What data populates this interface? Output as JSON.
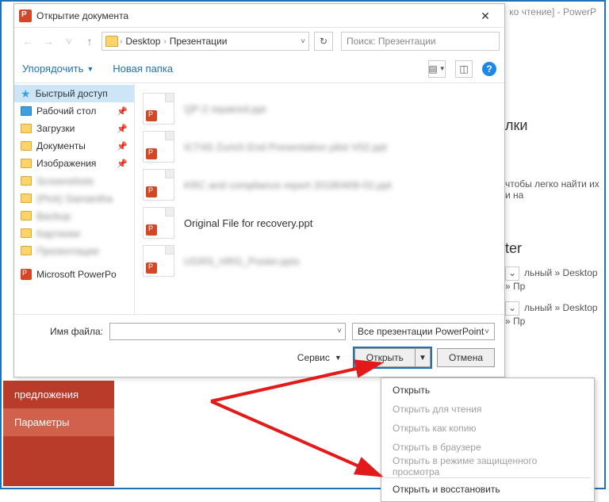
{
  "background": {
    "title_suffix": "ко чтение]  -  PowerP",
    "right": {
      "heading1": "лки",
      "para1a": "чтобы легко найти их",
      "para1b": "и на",
      "heading2": "ter",
      "crumb": "льный » Desktop » Пр",
      "crumb2": "льный » Desktop » Пр"
    },
    "side": {
      "item1": "предложения",
      "item2": "Параметры"
    }
  },
  "dialog": {
    "title": "Открытие документа",
    "breadcrumb": {
      "seg1": "Desktop",
      "seg2": "Презентации"
    },
    "search_placeholder": "Поиск: Презентации",
    "toolbar": {
      "organize": "Упорядочить",
      "new_folder": "Новая папка"
    },
    "sidebar": {
      "quick": "Быстрый доступ",
      "desktop": "Рабочий стол",
      "downloads": "Загрузки",
      "documents": "Документы",
      "images": "Изображения",
      "f1": "Screenshots",
      "f2": "(Pick) Samantha",
      "f3": "Backup",
      "f4": "Картинки",
      "f5": "Презентации",
      "msppt": "Microsoft PowerPo"
    },
    "files": {
      "f1": "QP-2 repaired.ppt",
      "f2": "ICT4S Zurich End Presentation pilot V02.ppt",
      "f3": "KRC and compliance report 20180409-02.ppt",
      "f4": "Original File for recovery.ppt",
      "f5": "UGRS_HRG_Poster.pptx"
    },
    "bottom": {
      "filename_label": "Имя файла:",
      "type_label": "Все презентации PowerPoint",
      "tools": "Сервис",
      "open": "Открыть",
      "cancel": "Отмена"
    }
  },
  "menu": {
    "m1": "Открыть",
    "m2": "Открыть для чтения",
    "m3": "Открыть как копию",
    "m4": "Открыть в браузере",
    "m5": "Открыть в режиме защищенного просмотра",
    "m6": "Открыть и восстановить"
  }
}
